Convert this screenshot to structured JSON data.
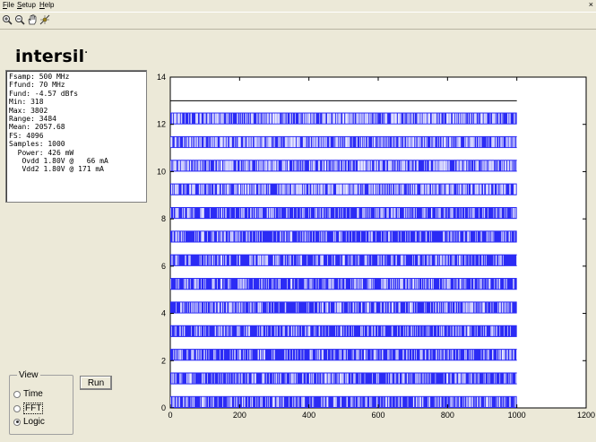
{
  "menu": [
    {
      "label": "File",
      "key": "F"
    },
    {
      "label": "Setup",
      "key": "S"
    },
    {
      "label": "Help",
      "key": "H"
    }
  ],
  "close_glyph": "×",
  "toolbar": [
    "zoom-in-icon",
    "zoom-out-icon",
    "pan-hand-icon",
    "data-cursor-icon"
  ],
  "logo": {
    "text": "intersil",
    "dot": "."
  },
  "info_lines": [
    "Fsamp: 500 MHz",
    "Ffund: 70 MHz",
    "Fund: -4.57 dBfs",
    "Min: 318",
    "Max: 3802",
    "Range: 3484",
    "Mean: 2057.68",
    "FS: 4096",
    "Samples: 1000",
    "  Power: 426 mW",
    "   Ovdd 1.80V @   66 mA",
    "   Vdd2 1.80V @ 171 mA"
  ],
  "view": {
    "legend": "View",
    "options": [
      {
        "label": "Time",
        "selected": false
      },
      {
        "label": "FFT",
        "selected": false
      },
      {
        "label": "Logic",
        "selected": true
      }
    ]
  },
  "run_label": "Run",
  "colors": {
    "trace": "#0000ff",
    "bg": "#ece9d8",
    "axis": "#000000"
  },
  "chart_data": {
    "type": "line",
    "title": "",
    "xlabel": "",
    "ylabel": "",
    "xlim": [
      0,
      1200
    ],
    "ylim": [
      0,
      14
    ],
    "xticks": [
      0,
      200,
      400,
      600,
      800,
      1000,
      1200
    ],
    "yticks": [
      0,
      2,
      4,
      6,
      8,
      10,
      12,
      14
    ],
    "samples": 1000,
    "series": [
      {
        "bit": 0,
        "level": 0
      },
      {
        "bit": 1,
        "level": 1
      },
      {
        "bit": 2,
        "level": 2
      },
      {
        "bit": 3,
        "level": 3
      },
      {
        "bit": 4,
        "level": 4
      },
      {
        "bit": 5,
        "level": 5
      },
      {
        "bit": 6,
        "level": 6
      },
      {
        "bit": 7,
        "level": 7
      },
      {
        "bit": 8,
        "level": 8
      },
      {
        "bit": 9,
        "level": 9
      },
      {
        "bit": 10,
        "level": 10
      },
      {
        "bit": 11,
        "level": 11
      },
      {
        "bit": 12,
        "level": 12
      },
      {
        "bit": 13,
        "level": 13,
        "constant": true
      }
    ]
  }
}
